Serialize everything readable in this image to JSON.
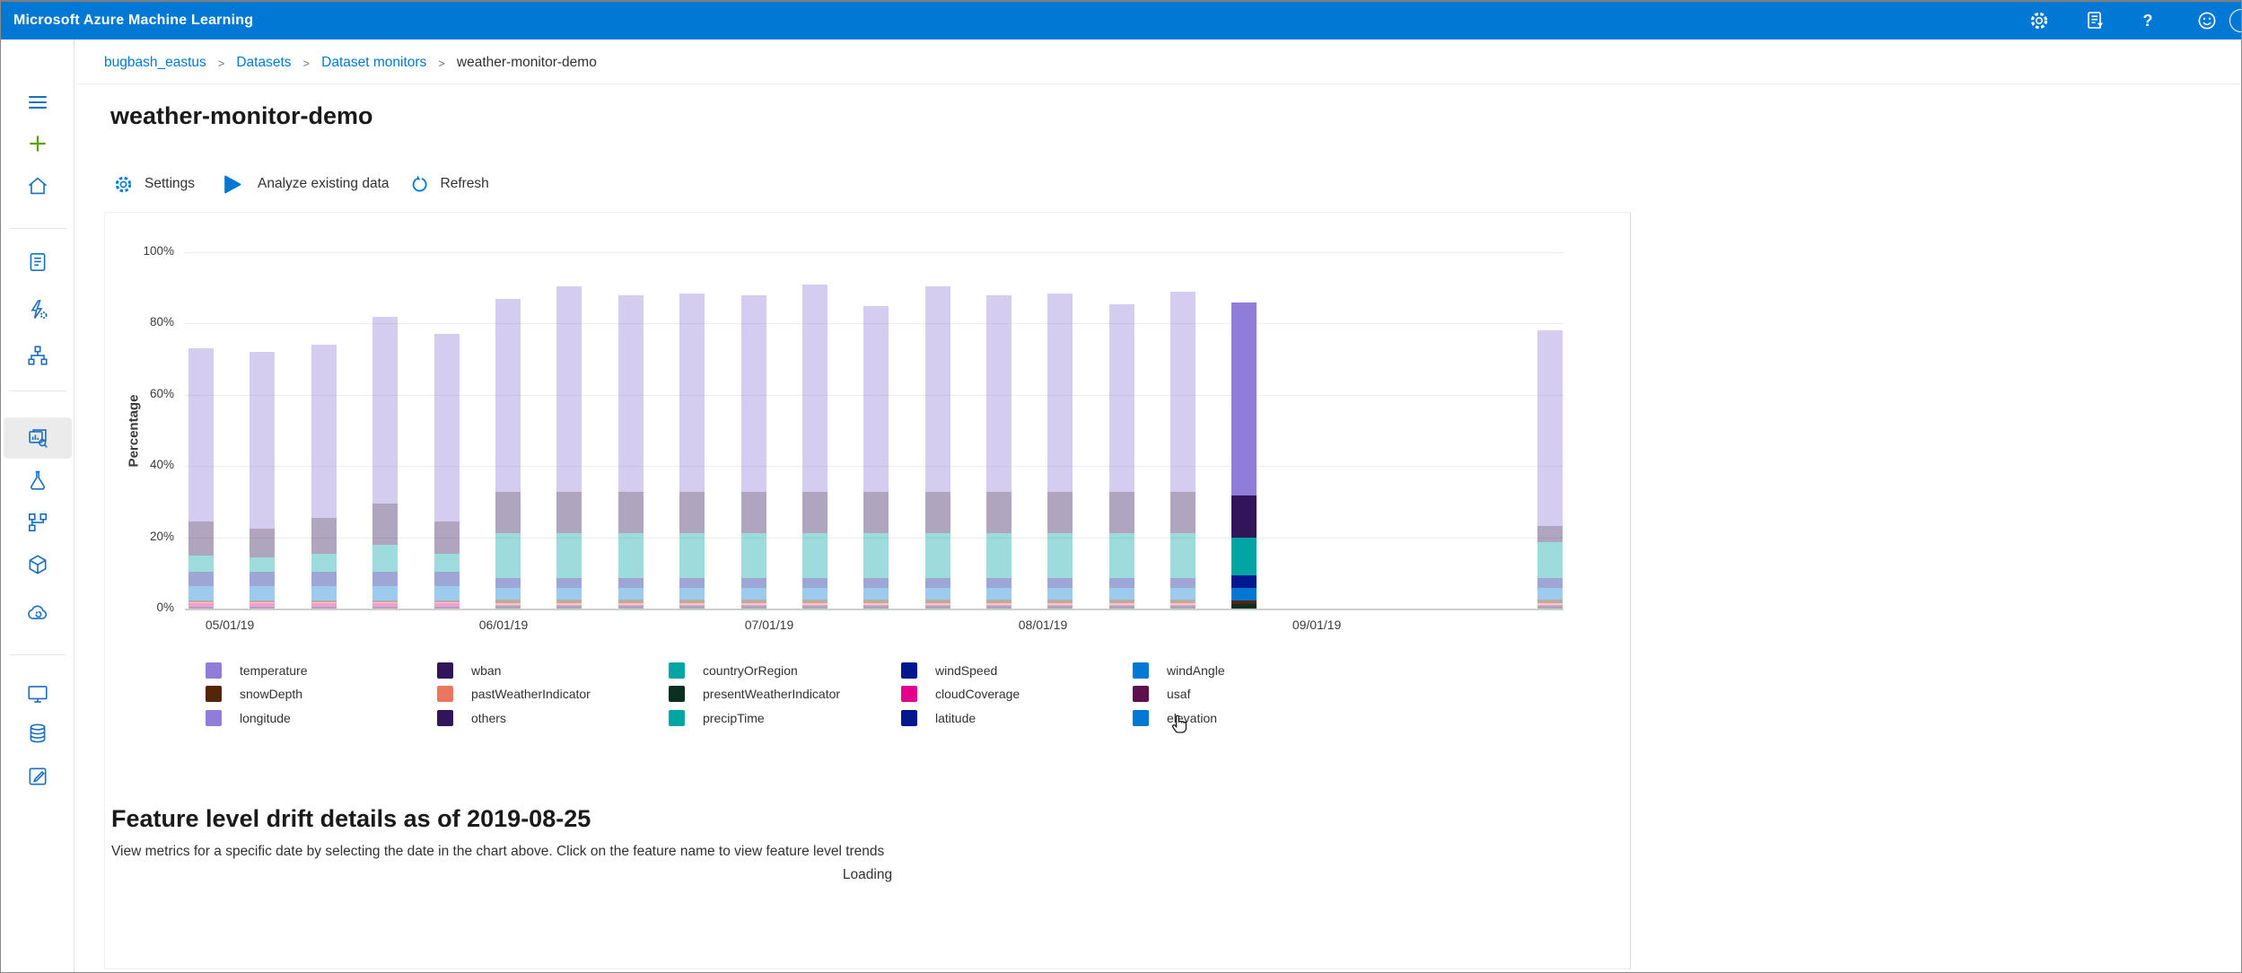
{
  "topbar": {
    "title": "Microsoft Azure Machine Learning",
    "icons": [
      "settings",
      "activity-log",
      "help",
      "feedback",
      "account"
    ]
  },
  "breadcrumb": {
    "separator": ">",
    "items": [
      {
        "label": "bugbash_eastus",
        "link": true
      },
      {
        "label": "Datasets",
        "link": true
      },
      {
        "label": "Dataset monitors",
        "link": true
      },
      {
        "label": "weather-monitor-demo",
        "link": false
      }
    ]
  },
  "page": {
    "title": "weather-monitor-demo"
  },
  "toolbar": {
    "settings": "Settings",
    "analyze": "Analyze existing data",
    "refresh": "Refresh"
  },
  "sidebar": {
    "items": [
      "menu",
      "new",
      "home",
      "notebooks",
      "automated-ml",
      "designer",
      "datasets",
      "experiments",
      "pipelines",
      "models",
      "endpoints",
      "compute",
      "datastores",
      "data-labeling"
    ],
    "selected": "datasets"
  },
  "colors": {
    "topbar": "#0078d4",
    "link": "#0078d4",
    "sidebar_icon": "#1a6fc0",
    "plus_green": "#57a300",
    "toolbar_icon": "#0078d4"
  },
  "chart_data": {
    "type": "stacked-bar",
    "ylabel": "Percentage",
    "ylim": [
      0,
      100
    ],
    "grid": true,
    "faded_opacity": 0.38,
    "yticks": [
      "100%",
      "80%",
      "60%",
      "40%",
      "20%",
      "0%"
    ],
    "xticks": [
      {
        "label": "05/01/19",
        "x": 3.26
      },
      {
        "label": "06/01/19",
        "x": 23.11
      },
      {
        "label": "07/01/19",
        "x": 42.38
      },
      {
        "label": "08/01/19",
        "x": 62.24
      },
      {
        "label": "09/01/19",
        "x": 82.1
      }
    ],
    "series_colors": {
      "temperature": "#8f7dd9",
      "wban": "#32145a",
      "countryOrRegion": "#00a5a4",
      "windSpeed": "#00188f",
      "windAngle": "#0078d4",
      "snowDepth": "#552508",
      "pastWeatherIndicator": "#e8775e",
      "presentWeatherIndicator": "#0b2f20",
      "cloudCoverage": "#e3008c",
      "usaf": "#5c114d",
      "others": "#32145a"
    },
    "legend": [
      {
        "label": "temperature",
        "color": "#8f7dd9"
      },
      {
        "label": "wban",
        "color": "#32145a"
      },
      {
        "label": "countryOrRegion",
        "color": "#00a5a4"
      },
      {
        "label": "windSpeed",
        "color": "#00188f"
      },
      {
        "label": "windAngle",
        "color": "#0078d4"
      },
      {
        "label": "snowDepth",
        "color": "#552508"
      },
      {
        "label": "pastWeatherIndicator",
        "color": "#e8775e"
      },
      {
        "label": "presentWeatherIndicator",
        "color": "#0b2f20"
      },
      {
        "label": "cloudCoverage",
        "color": "#e3008c"
      },
      {
        "label": "usaf",
        "color": "#5c114d"
      },
      {
        "label": "longitude",
        "color": "#8f7dd9"
      },
      {
        "label": "others",
        "color": "#32145a"
      },
      {
        "label": "precipTime",
        "color": "#00a5a4"
      },
      {
        "label": "latitude",
        "color": "#00188f"
      },
      {
        "label": "elevation",
        "color": "#0078d4"
      }
    ],
    "bars": [
      {
        "x": 1.17,
        "selected": false,
        "stack": [
          [
            "others",
            0.5
          ],
          [
            "cloudCoverage",
            1.0
          ],
          [
            "pastWeatherIndicator",
            0.4
          ],
          [
            "snowDepth",
            0.3
          ],
          [
            "windAngle",
            4.0
          ],
          [
            "windSpeed",
            4.2
          ],
          [
            "countryOrRegion",
            4.5
          ],
          [
            "wban",
            9.5
          ],
          [
            "temperature",
            48.6
          ]
        ]
      },
      {
        "x": 5.6,
        "selected": false,
        "stack": [
          [
            "others",
            0.5
          ],
          [
            "cloudCoverage",
            1.0
          ],
          [
            "pastWeatherIndicator",
            0.4
          ],
          [
            "snowDepth",
            0.3
          ],
          [
            "windAngle",
            4.0
          ],
          [
            "windSpeed",
            4.2
          ],
          [
            "countryOrRegion",
            4.0
          ],
          [
            "wban",
            8.0
          ],
          [
            "temperature",
            49.6
          ]
        ]
      },
      {
        "x": 10.09,
        "selected": false,
        "stack": [
          [
            "others",
            0.5
          ],
          [
            "cloudCoverage",
            1.0
          ],
          [
            "pastWeatherIndicator",
            0.4
          ],
          [
            "snowDepth",
            0.3
          ],
          [
            "windAngle",
            4.0
          ],
          [
            "windSpeed",
            4.2
          ],
          [
            "countryOrRegion",
            5.0
          ],
          [
            "wban",
            10.0
          ],
          [
            "temperature",
            48.6
          ]
        ]
      },
      {
        "x": 14.52,
        "selected": false,
        "stack": [
          [
            "others",
            0.5
          ],
          [
            "cloudCoverage",
            1.0
          ],
          [
            "pastWeatherIndicator",
            0.4
          ],
          [
            "snowDepth",
            0.3
          ],
          [
            "windAngle",
            4.0
          ],
          [
            "windSpeed",
            4.2
          ],
          [
            "countryOrRegion",
            7.5
          ],
          [
            "wban",
            11.5
          ],
          [
            "temperature",
            52.6
          ]
        ]
      },
      {
        "x": 19.01,
        "selected": false,
        "stack": [
          [
            "others",
            0.5
          ],
          [
            "cloudCoverage",
            1.0
          ],
          [
            "pastWeatherIndicator",
            0.4
          ],
          [
            "snowDepth",
            0.3
          ],
          [
            "windAngle",
            4.0
          ],
          [
            "windSpeed",
            4.2
          ],
          [
            "countryOrRegion",
            5.0
          ],
          [
            "wban",
            9.0
          ],
          [
            "temperature",
            52.6
          ]
        ]
      },
      {
        "x": 23.44,
        "selected": false,
        "stack": [
          [
            "presentWeatherIndicator",
            0.3
          ],
          [
            "others",
            0.5
          ],
          [
            "cloudCoverage",
            0.3
          ],
          [
            "pastWeatherIndicator",
            0.4
          ],
          [
            "snowDepth",
            1.0
          ],
          [
            "windAngle",
            3.2
          ],
          [
            "windSpeed",
            3.0
          ],
          [
            "countryOrRegion",
            12.5
          ],
          [
            "wban",
            11.5
          ],
          [
            "temperature",
            54.3
          ]
        ]
      },
      {
        "x": 27.86,
        "selected": false,
        "stack": [
          [
            "presentWeatherIndicator",
            0.3
          ],
          [
            "others",
            0.5
          ],
          [
            "cloudCoverage",
            0.3
          ],
          [
            "pastWeatherIndicator",
            0.4
          ],
          [
            "snowDepth",
            1.0
          ],
          [
            "windAngle",
            3.2
          ],
          [
            "windSpeed",
            3.0
          ],
          [
            "countryOrRegion",
            12.5
          ],
          [
            "wban",
            11.5
          ],
          [
            "temperature",
            57.8
          ]
        ]
      },
      {
        "x": 32.36,
        "selected": false,
        "stack": [
          [
            "presentWeatherIndicator",
            0.3
          ],
          [
            "others",
            0.5
          ],
          [
            "cloudCoverage",
            0.3
          ],
          [
            "pastWeatherIndicator",
            0.4
          ],
          [
            "snowDepth",
            1.0
          ],
          [
            "windAngle",
            3.2
          ],
          [
            "windSpeed",
            3.0
          ],
          [
            "countryOrRegion",
            12.5
          ],
          [
            "wban",
            11.5
          ],
          [
            "temperature",
            55.3
          ]
        ]
      },
      {
        "x": 36.78,
        "selected": false,
        "stack": [
          [
            "presentWeatherIndicator",
            0.3
          ],
          [
            "others",
            0.5
          ],
          [
            "cloudCoverage",
            0.3
          ],
          [
            "pastWeatherIndicator",
            0.4
          ],
          [
            "snowDepth",
            1.0
          ],
          [
            "windAngle",
            3.2
          ],
          [
            "windSpeed",
            3.0
          ],
          [
            "countryOrRegion",
            12.5
          ],
          [
            "wban",
            11.5
          ],
          [
            "temperature",
            55.8
          ]
        ]
      },
      {
        "x": 41.28,
        "selected": false,
        "stack": [
          [
            "presentWeatherIndicator",
            0.3
          ],
          [
            "others",
            0.5
          ],
          [
            "cloudCoverage",
            0.3
          ],
          [
            "pastWeatherIndicator",
            0.4
          ],
          [
            "snowDepth",
            1.0
          ],
          [
            "windAngle",
            3.2
          ],
          [
            "windSpeed",
            3.0
          ],
          [
            "countryOrRegion",
            12.5
          ],
          [
            "wban",
            11.5
          ],
          [
            "temperature",
            55.3
          ]
        ]
      },
      {
        "x": 45.7,
        "selected": false,
        "stack": [
          [
            "presentWeatherIndicator",
            0.3
          ],
          [
            "others",
            0.5
          ],
          [
            "cloudCoverage",
            0.3
          ],
          [
            "pastWeatherIndicator",
            0.4
          ],
          [
            "snowDepth",
            1.0
          ],
          [
            "windAngle",
            3.2
          ],
          [
            "windSpeed",
            3.0
          ],
          [
            "countryOrRegion",
            12.5
          ],
          [
            "wban",
            11.5
          ],
          [
            "temperature",
            58.3
          ]
        ]
      },
      {
        "x": 50.13,
        "selected": false,
        "stack": [
          [
            "presentWeatherIndicator",
            0.3
          ],
          [
            "others",
            0.5
          ],
          [
            "cloudCoverage",
            0.3
          ],
          [
            "pastWeatherIndicator",
            0.4
          ],
          [
            "snowDepth",
            1.0
          ],
          [
            "windAngle",
            3.2
          ],
          [
            "windSpeed",
            3.0
          ],
          [
            "countryOrRegion",
            12.5
          ],
          [
            "wban",
            11.5
          ],
          [
            "temperature",
            52.3
          ]
        ]
      },
      {
        "x": 54.62,
        "selected": false,
        "stack": [
          [
            "presentWeatherIndicator",
            0.3
          ],
          [
            "others",
            0.5
          ],
          [
            "cloudCoverage",
            0.3
          ],
          [
            "pastWeatherIndicator",
            0.4
          ],
          [
            "snowDepth",
            1.0
          ],
          [
            "windAngle",
            3.2
          ],
          [
            "windSpeed",
            3.0
          ],
          [
            "countryOrRegion",
            12.5
          ],
          [
            "wban",
            11.5
          ],
          [
            "temperature",
            57.8
          ]
        ]
      },
      {
        "x": 59.05,
        "selected": false,
        "stack": [
          [
            "presentWeatherIndicator",
            0.3
          ],
          [
            "others",
            0.5
          ],
          [
            "cloudCoverage",
            0.3
          ],
          [
            "pastWeatherIndicator",
            0.4
          ],
          [
            "snowDepth",
            1.0
          ],
          [
            "windAngle",
            3.2
          ],
          [
            "windSpeed",
            3.0
          ],
          [
            "countryOrRegion",
            12.5
          ],
          [
            "wban",
            11.5
          ],
          [
            "temperature",
            55.3
          ]
        ]
      },
      {
        "x": 63.48,
        "selected": false,
        "stack": [
          [
            "presentWeatherIndicator",
            0.3
          ],
          [
            "others",
            0.5
          ],
          [
            "cloudCoverage",
            0.3
          ],
          [
            "pastWeatherIndicator",
            0.4
          ],
          [
            "snowDepth",
            1.0
          ],
          [
            "windAngle",
            3.2
          ],
          [
            "windSpeed",
            3.0
          ],
          [
            "countryOrRegion",
            12.5
          ],
          [
            "wban",
            11.5
          ],
          [
            "temperature",
            55.8
          ]
        ]
      },
      {
        "x": 67.97,
        "selected": false,
        "stack": [
          [
            "presentWeatherIndicator",
            0.3
          ],
          [
            "others",
            0.5
          ],
          [
            "cloudCoverage",
            0.3
          ],
          [
            "pastWeatherIndicator",
            0.4
          ],
          [
            "snowDepth",
            1.0
          ],
          [
            "windAngle",
            3.2
          ],
          [
            "windSpeed",
            3.0
          ],
          [
            "countryOrRegion",
            12.5
          ],
          [
            "wban",
            11.5
          ],
          [
            "temperature",
            52.8
          ]
        ]
      },
      {
        "x": 72.4,
        "selected": false,
        "stack": [
          [
            "presentWeatherIndicator",
            0.3
          ],
          [
            "others",
            0.5
          ],
          [
            "cloudCoverage",
            0.3
          ],
          [
            "pastWeatherIndicator",
            0.4
          ],
          [
            "snowDepth",
            1.0
          ],
          [
            "windAngle",
            3.2
          ],
          [
            "windSpeed",
            3.0
          ],
          [
            "countryOrRegion",
            12.5
          ],
          [
            "wban",
            11.5
          ],
          [
            "temperature",
            56.3
          ]
        ]
      },
      {
        "x": 76.82,
        "selected": true,
        "stack": [
          [
            "presentWeatherIndicator",
            1.2
          ],
          [
            "snowDepth",
            1.2
          ],
          [
            "windAngle",
            3.4
          ],
          [
            "windSpeed",
            3.6
          ],
          [
            "countryOrRegion",
            10.4
          ],
          [
            "wban",
            12.0
          ],
          [
            "temperature",
            54.2
          ]
        ]
      },
      {
        "x": 99.02,
        "selected": false,
        "stack": [
          [
            "presentWeatherIndicator",
            0.3
          ],
          [
            "others",
            0.5
          ],
          [
            "cloudCoverage",
            0.3
          ],
          [
            "pastWeatherIndicator",
            0.4
          ],
          [
            "snowDepth",
            1.0
          ],
          [
            "windAngle",
            3.2
          ],
          [
            "windSpeed",
            3.0
          ],
          [
            "countryOrRegion",
            10.0
          ],
          [
            "wban",
            4.5
          ],
          [
            "temperature",
            54.8
          ]
        ]
      }
    ]
  },
  "details": {
    "heading": "Feature level drift details as of 2019-08-25",
    "description": "View metrics for a specific date by selecting the date in the chart above. Click on the feature name to view feature level trends",
    "loading": "Loading"
  }
}
